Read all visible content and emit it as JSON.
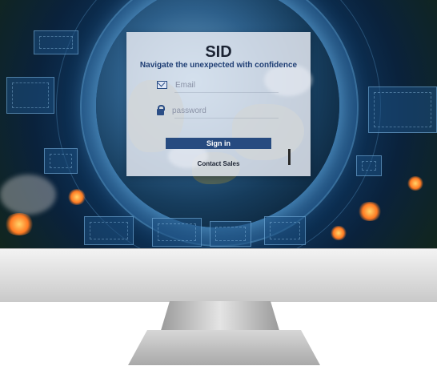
{
  "login": {
    "title": "SID",
    "tagline": "Navigate the unexpected with confidence",
    "email_placeholder": "Email",
    "password_placeholder": "password",
    "signin_label": "Sign in",
    "contact_label": "Contact Sales"
  },
  "icons": {
    "email": "mail-icon",
    "password": "lock-icon"
  },
  "colors": {
    "accent": "#274b80",
    "tagline": "#1f3e74",
    "panel": "#ebeef5"
  }
}
